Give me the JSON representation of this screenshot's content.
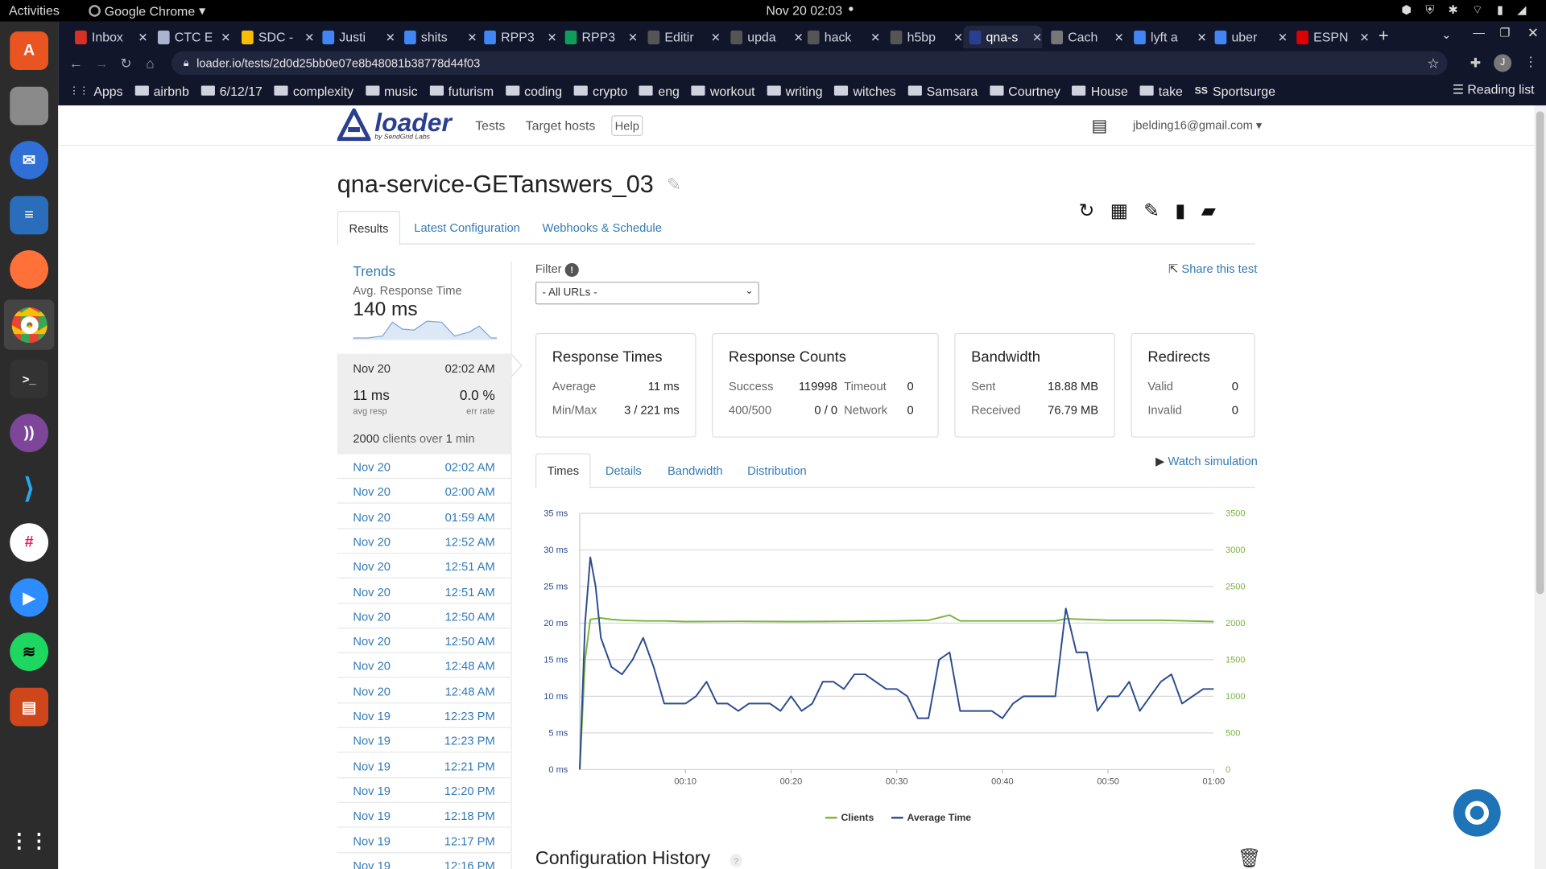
{
  "os": {
    "activities": "Activities",
    "app_name": "Google Chrome",
    "clock": "Nov 20  02:03"
  },
  "browser": {
    "tabs": [
      {
        "label": "Inbox",
        "color": "#d93025"
      },
      {
        "label": "CTC E",
        "color": "#aab4d0"
      },
      {
        "label": "SDC -",
        "color": "#fbbc04"
      },
      {
        "label": "Justi",
        "color": "#4285f4"
      },
      {
        "label": "shits",
        "color": "#4285f4"
      },
      {
        "label": "RPP3",
        "color": "#4285f4"
      },
      {
        "label": "RPP3",
        "color": "#0f9d58"
      },
      {
        "label": "Editir",
        "color": "#555"
      },
      {
        "label": "upda",
        "color": "#555"
      },
      {
        "label": "hack",
        "color": "#555"
      },
      {
        "label": "h5bp",
        "color": "#555"
      },
      {
        "label": "qna-s",
        "color": "#2a3f8f"
      },
      {
        "label": "Cach",
        "color": "#777"
      },
      {
        "label": "lyft a",
        "color": "#4285f4"
      },
      {
        "label": "uber",
        "color": "#4285f4"
      },
      {
        "label": "ESPN",
        "color": "#d00"
      }
    ],
    "url": "loader.io/tests/2d0d25bb0e07e8b48081b38778d44f03",
    "bookmarks": [
      "Apps",
      "airbnb",
      "6/12/17",
      "complexity",
      "music",
      "futurism",
      "coding",
      "crypto",
      "eng",
      "workout",
      "writing",
      "witches",
      "Samsara",
      "Courtney",
      "House",
      "take",
      "Sportsurge"
    ],
    "reading_list": "Reading list"
  },
  "app": {
    "logo_word": "loader",
    "logo_sub": "by SendGrid Labs",
    "nav": [
      "Tests",
      "Target hosts",
      "Help"
    ],
    "user_email": "jbelding16@gmail.com"
  },
  "test": {
    "title": "qna-service-GETanswers_03",
    "tabs": [
      "Results",
      "Latest Configuration",
      "Webhooks & Schedule"
    ]
  },
  "trends": {
    "title": "Trends",
    "subtitle": "Avg. Response Time",
    "value": "140 ms",
    "selected": {
      "date": "Nov 20",
      "time": "02:02 AM",
      "avg_resp": "11 ms",
      "avg_resp_label": "avg resp",
      "err_rate": "0.0 %",
      "err_rate_label": "err rate",
      "clients_num": "2000",
      "clients_text": "clients over",
      "duration_num": "1",
      "duration_unit": "min"
    },
    "runs": [
      {
        "date": "Nov 20",
        "time": "02:02 AM"
      },
      {
        "date": "Nov 20",
        "time": "02:00 AM"
      },
      {
        "date": "Nov 20",
        "time": "01:59 AM"
      },
      {
        "date": "Nov 20",
        "time": "12:52 AM"
      },
      {
        "date": "Nov 20",
        "time": "12:51 AM"
      },
      {
        "date": "Nov 20",
        "time": "12:51 AM"
      },
      {
        "date": "Nov 20",
        "time": "12:50 AM"
      },
      {
        "date": "Nov 20",
        "time": "12:50 AM"
      },
      {
        "date": "Nov 20",
        "time": "12:48 AM"
      },
      {
        "date": "Nov 20",
        "time": "12:48 AM"
      },
      {
        "date": "Nov 19",
        "time": "12:23 PM"
      },
      {
        "date": "Nov 19",
        "time": "12:23 PM"
      },
      {
        "date": "Nov 19",
        "time": "12:21 PM"
      },
      {
        "date": "Nov 19",
        "time": "12:20 PM"
      },
      {
        "date": "Nov 19",
        "time": "12:18 PM"
      },
      {
        "date": "Nov 19",
        "time": "12:17 PM"
      },
      {
        "date": "Nov 19",
        "time": "12:16 PM"
      }
    ]
  },
  "filter": {
    "label": "Filter",
    "selected": "- All URLs -",
    "share": "Share this test"
  },
  "cards": {
    "response_times": {
      "title": "Response Times",
      "average_label": "Average",
      "average": "11 ms",
      "minmax_label": "Min/Max",
      "minmax": "3 / 221 ms"
    },
    "response_counts": {
      "title": "Response Counts",
      "success_label": "Success",
      "success": "119998",
      "timeout_label": "Timeout",
      "timeout": "0",
      "err_label": "400/500",
      "err": "0 / 0",
      "network_label": "Network",
      "network": "0"
    },
    "bandwidth": {
      "title": "Bandwidth",
      "sent_label": "Sent",
      "sent": "18.88 MB",
      "received_label": "Received",
      "received": "76.79 MB"
    },
    "redirects": {
      "title": "Redirects",
      "valid_label": "Valid",
      "valid": "0",
      "invalid_label": "Invalid",
      "invalid": "0"
    }
  },
  "subtabs": [
    "Times",
    "Details",
    "Bandwidth",
    "Distribution"
  ],
  "watch_simulation": "Watch simulation",
  "config_history": "Configuration History",
  "chart_data": {
    "type": "line",
    "x_ticks": [
      "00:10",
      "00:20",
      "00:30",
      "00:40",
      "00:50",
      "01:00"
    ],
    "y_left_ticks": [
      "0 ms",
      "5 ms",
      "10 ms",
      "15 ms",
      "20 ms",
      "25 ms",
      "30 ms",
      "35 ms"
    ],
    "y_right_ticks": [
      "0",
      "500",
      "1000",
      "1500",
      "2000",
      "2500",
      "3000",
      "3500"
    ],
    "ylim_left": [
      0,
      35
    ],
    "ylim_right": [
      0,
      3500
    ],
    "xlim": [
      0,
      60
    ],
    "grid": true,
    "legend_position": "bottom",
    "series": [
      {
        "name": "Clients",
        "axis": "right",
        "color": "#7ab33e",
        "x": [
          0,
          0.5,
          1,
          2,
          3,
          4,
          6,
          8,
          10,
          15,
          20,
          25,
          30,
          33,
          35,
          36,
          40,
          45,
          46,
          50,
          55,
          60
        ],
        "values": [
          0,
          1500,
          2050,
          2070,
          2050,
          2040,
          2030,
          2030,
          2020,
          2025,
          2020,
          2025,
          2030,
          2040,
          2110,
          2030,
          2030,
          2030,
          2060,
          2040,
          2040,
          2020
        ]
      },
      {
        "name": "Average Time",
        "axis": "left",
        "color": "#2b4b8f",
        "x": [
          0,
          0.5,
          1,
          1.5,
          2,
          3,
          4,
          5,
          6,
          7,
          8,
          9,
          10,
          11,
          12,
          13,
          14,
          15,
          16,
          17,
          18,
          19,
          20,
          21,
          22,
          23,
          24,
          25,
          26,
          27,
          28,
          29,
          30,
          31,
          32,
          33,
          34,
          35,
          36,
          37,
          38,
          39,
          40,
          41,
          42,
          43,
          44,
          45,
          46,
          47,
          48,
          49,
          50,
          51,
          52,
          53,
          54,
          55,
          56,
          57,
          58,
          59,
          60
        ],
        "values": [
          0,
          20,
          29,
          25,
          18,
          14,
          13,
          15,
          18,
          14,
          9,
          9,
          9,
          10,
          12,
          9,
          9,
          8,
          9,
          9,
          9,
          8,
          10,
          8,
          9,
          12,
          12,
          11,
          13,
          13,
          12,
          11,
          11,
          10,
          7,
          7,
          15,
          16,
          8,
          8,
          8,
          8,
          7,
          9,
          10,
          10,
          10,
          10,
          22,
          16,
          16,
          8,
          10,
          10,
          12,
          8,
          10,
          12,
          13,
          9,
          10,
          11,
          11
        ]
      }
    ]
  }
}
